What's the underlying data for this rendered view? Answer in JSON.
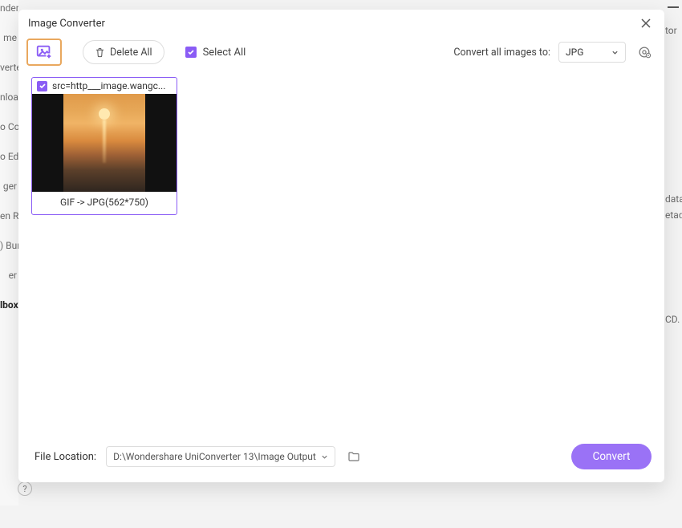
{
  "bg_sidebar_items": [
    "nder",
    "me",
    "verte",
    "nloa",
    "o Co",
    "o Ed",
    "ger",
    "en R",
    ") Bur",
    "er",
    "lbox"
  ],
  "bg_right_items": [
    "tor",
    "data",
    "etada",
    "CD."
  ],
  "dialog": {
    "title": "Image Converter",
    "toolbar": {
      "delete_all": "Delete All",
      "select_all_label": "Select All",
      "convert_label": "Convert all images to:",
      "format_selected": "JPG"
    },
    "images": [
      {
        "name": "src=http___image.wangc...",
        "caption": "GIF -> JPG(562*750)"
      }
    ],
    "footer": {
      "location_label": "File Location:",
      "path": "D:\\Wondershare UniConverter 13\\Image Output",
      "convert_btn": "Convert"
    }
  }
}
